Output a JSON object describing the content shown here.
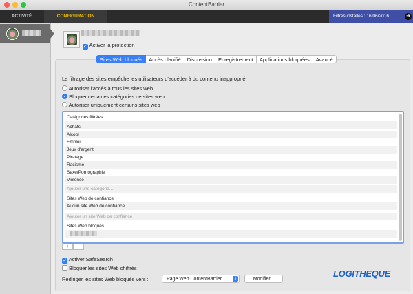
{
  "window": {
    "title": "ContentBarrier"
  },
  "colors": {
    "accent": "#3a7ff6",
    "nav_active_text": "#f0c000",
    "filters_bg": "#3f4fa6",
    "logo": "#1e63c8"
  },
  "nav": {
    "tabs": [
      "ACTIVITÉ",
      "CONFIGURATION"
    ],
    "active": "CONFIGURATION",
    "filters_label": "Filtres installés : 16/06/2016"
  },
  "user": {
    "protection_label": "Activer la protection",
    "protection_checked": true
  },
  "tabs": [
    "Sites Web bloqués",
    "Accès planifié",
    "Discussion",
    "Enregistrement",
    "Applications bloquées",
    "Avancé"
  ],
  "active_tab": "Sites Web bloqués",
  "description": "Le filtrage des sites empêche les utilisateurs d'accéder à du contenu inapproprié.",
  "options": [
    {
      "label": "Autoriser l'accès à tous les sites web",
      "selected": false
    },
    {
      "label": "Bloquer certaines catégories de sites web",
      "selected": true
    },
    {
      "label": "Autoriser uniquement certains sites web",
      "selected": false
    }
  ],
  "list": {
    "categories_header": "Catégories filtrées",
    "categories": [
      "Achats",
      "Alcool",
      "Emploi",
      "Jeux d'argent",
      "Piratage",
      "Racisme",
      "Sexe/Pornographie",
      "Violence"
    ],
    "add_category_placeholder": "Ajouter une catégorie...",
    "trusted_header": "Sites Web de confiance",
    "trusted_empty": "Aucun site Web de confiance",
    "add_trusted_placeholder": "Ajouter un site Web de confiance",
    "blocked_header": "Sites Web bloqués"
  },
  "bottom": {
    "safesearch_label": "Activer SafeSearch",
    "safesearch_checked": true,
    "block_encrypted_label": "Bloquer les sites Web chiffrés",
    "block_encrypted_checked": false,
    "redirect_label": "Rediriger les sites Web bloqués vers :",
    "redirect_value": "Page Web ContentBarrier",
    "modify_button": "Modifier...",
    "add_button": "+",
    "remove_button": "−"
  },
  "logo_text": "LOGITHEQUE"
}
